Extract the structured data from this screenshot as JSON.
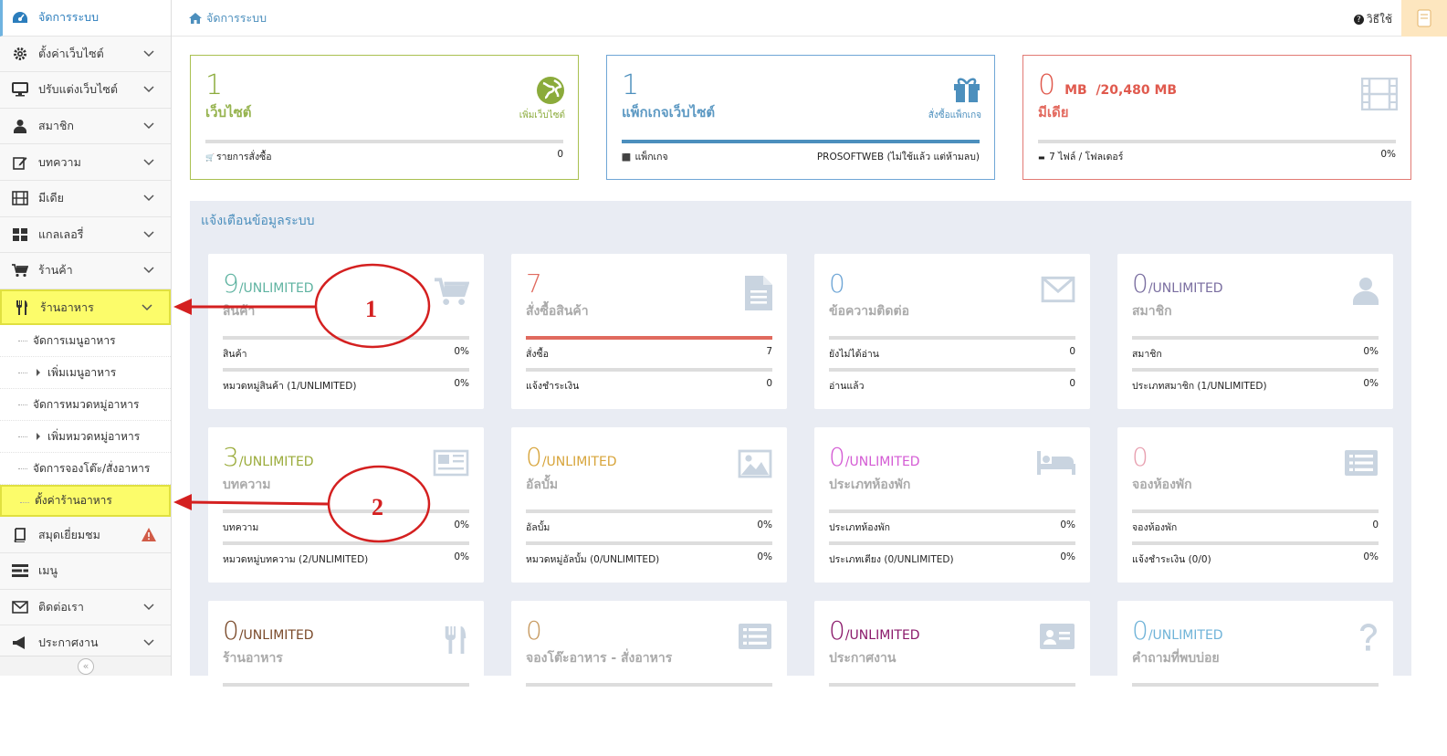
{
  "sidebar": {
    "items": [
      {
        "label": "จัดการระบบ",
        "icon": "dashboard-icon",
        "chevron": false,
        "active": true
      },
      {
        "label": "ตั้งค่าเว็บไซต์",
        "icon": "gear-icon",
        "chevron": true
      },
      {
        "label": "ปรับแต่งเว็บไซต์",
        "icon": "desktop-icon",
        "chevron": true
      },
      {
        "label": "สมาชิก",
        "icon": "user-icon",
        "chevron": true
      },
      {
        "label": "บทความ",
        "icon": "edit-icon",
        "chevron": true
      },
      {
        "label": "มีเดีย",
        "icon": "film-icon",
        "chevron": true
      },
      {
        "label": "แกลเลอรี่",
        "icon": "grid-icon",
        "chevron": true
      },
      {
        "label": "ร้านค้า",
        "icon": "cart-icon",
        "chevron": true
      },
      {
        "label": "ร้านอาหาร",
        "icon": "cutlery-icon",
        "chevron": true,
        "highlight": true
      }
    ],
    "restaurant_sub": [
      {
        "label": "จัดการเมนูอาหาร",
        "level": 1
      },
      {
        "label": "เพิ่มเมนูอาหาร",
        "level": 2
      },
      {
        "label": "จัดการหมวดหมู่อาหาร",
        "level": 1
      },
      {
        "label": "เพิ่มหมวดหมู่อาหาร",
        "level": 2
      },
      {
        "label": "จัดการจองโต๊ะ/สั่งอาหาร",
        "level": 1
      },
      {
        "label": "ตั้งค่าร้านอาหาร",
        "level": 1,
        "highlight": true
      }
    ],
    "items_after": [
      {
        "label": "สมุดเยี่ยมชม",
        "icon": "book-icon",
        "chevron": false,
        "warning": true
      },
      {
        "label": "เมนู",
        "icon": "menu-list-icon",
        "chevron": false
      },
      {
        "label": "ติดต่อเรา",
        "icon": "envelope-icon",
        "chevron": true
      },
      {
        "label": "ประกาศงาน",
        "icon": "megaphone-icon",
        "chevron": true
      }
    ],
    "collapse_glyph": "«"
  },
  "topbar": {
    "breadcrumb": "จัดการระบบ",
    "help": "วิธีใช้"
  },
  "summary": [
    {
      "num": "1",
      "unit": "",
      "label": "เว็บไซต์",
      "link": "เพิ่มเว็บไซต์",
      "foot_left": "รายการสั่งซื้อ",
      "foot_right": "0",
      "color": "#8bab3b",
      "border": "#a9c050",
      "icon": "globe-icon",
      "bar_fill": 0,
      "bar_color": "#ddd"
    },
    {
      "num": "1",
      "unit": "",
      "label": "แพ็กเกจเว็บไซต์",
      "link": "สั่งซื้อแพ็กเกจ",
      "foot_left": "แพ็กเกจ",
      "foot_right": "PROSOFTWEB (ไม่ใช้แล้ว แต่ห้ามลบ)",
      "color": "#4c8fbd",
      "border": "#6fa6d6",
      "icon": "gift-icon",
      "bar_fill": 1,
      "bar_color": "#4c8fbd"
    },
    {
      "num": "0",
      "unit": "MB  /20,480 MB",
      "label": "มีเดีย",
      "link": "",
      "foot_left": "7 ไฟล์ / โฟลเดอร์",
      "foot_right": "0%",
      "color": "#e05a4e",
      "border": "#e27a74",
      "icon": "film-icon",
      "bar_fill": 0,
      "bar_color": "#ddd"
    }
  ],
  "panel_title": "แจ้งเตือนข้อมูลระบบ",
  "cards": [
    {
      "num": "9",
      "unit": "/UNLIMITED",
      "label": "สินค้า",
      "icon": "cart-icon",
      "color": "#5fb3a1",
      "r1": [
        "สินค้า",
        "0%"
      ],
      "r2": [
        "หมวดหมู่สินค้า (1/UNLIMITED)",
        "0%"
      ],
      "bar1": 0,
      "barcolor": "#ddd"
    },
    {
      "num": "7",
      "unit": "",
      "label": "สั่งซื้อสินค้า",
      "icon": "file-icon",
      "color": "#e06a5e",
      "r1": [
        "สั่งซื้อ",
        "7"
      ],
      "r2": [
        "แจ้งชำระเงิน",
        "0"
      ],
      "bar1": 1,
      "barcolor": "#e06a5e"
    },
    {
      "num": "0",
      "unit": "",
      "label": "ข้อความติดต่อ",
      "icon": "envelope-icon",
      "color": "#6fa6d6",
      "r1": [
        "ยังไม่ได้อ่าน",
        "0"
      ],
      "r2": [
        "อ่านแล้ว",
        "0"
      ],
      "bar1": 0,
      "barcolor": "#ddd"
    },
    {
      "num": "0",
      "unit": "/UNLIMITED",
      "label": "สมาชิก",
      "icon": "user-icon",
      "color": "#7a6ea0",
      "r1": [
        "สมาชิก",
        "0%"
      ],
      "r2": [
        "ประเภทสมาชิก (1/UNLIMITED)",
        "0%"
      ],
      "bar1": 0,
      "barcolor": "#ddd"
    },
    {
      "num": "3",
      "unit": "/UNLIMITED",
      "label": "บทความ",
      "icon": "newspaper-icon",
      "color": "#9aab3a",
      "r1": [
        "บทความ",
        "0%"
      ],
      "r2": [
        "หมวดหมู่บทความ (2/UNLIMITED)",
        "0%"
      ],
      "bar1": 0,
      "barcolor": "#ddd"
    },
    {
      "num": "0",
      "unit": "/UNLIMITED",
      "label": "อัลบั้ม",
      "icon": "picture-icon",
      "color": "#d7a43a",
      "r1": [
        "อัลบั้ม",
        "0%"
      ],
      "r2": [
        "หมวดหมู่อัลบั้ม (0/UNLIMITED)",
        "0%"
      ],
      "bar1": 0,
      "barcolor": "#ddd"
    },
    {
      "num": "0",
      "unit": "/UNLIMITED",
      "label": "ประเภทห้องพัก",
      "icon": "bed-icon",
      "color": "#d45bd4",
      "r1": [
        "ประเภทห้องพัก",
        "0%"
      ],
      "r2": [
        "ประเภทเตียง (0/UNLIMITED)",
        "0%"
      ],
      "bar1": 0,
      "barcolor": "#ddd"
    },
    {
      "num": "0",
      "unit": "",
      "label": "จองห้องพัก",
      "icon": "list-icon",
      "color": "#e8a0b0",
      "r1": [
        "จองห้องพัก",
        "0"
      ],
      "r2": [
        "แจ้งชำระเงิน (0/0)",
        "0%"
      ],
      "bar1": 0,
      "barcolor": "#ddd"
    },
    {
      "num": "0",
      "unit": "/UNLIMITED",
      "label": "ร้านอาหาร",
      "icon": "cutlery-icon",
      "color": "#7a4a2a",
      "r1": [
        "",
        ""
      ],
      "r2": [
        "",
        ""
      ],
      "bar1": 0,
      "barcolor": "#ddd"
    },
    {
      "num": "0",
      "unit": "",
      "label": "จองโต๊ะอาหาร - สั่งอาหาร",
      "icon": "list-icon",
      "color": "#c79a60",
      "r1": [
        "",
        ""
      ],
      "r2": [
        "",
        ""
      ],
      "bar1": 0,
      "barcolor": "#ddd"
    },
    {
      "num": "0",
      "unit": "/UNLIMITED",
      "label": "ประกาศงาน",
      "icon": "id-card-icon",
      "color": "#8b1a6b",
      "r1": [
        "",
        ""
      ],
      "r2": [
        "",
        ""
      ],
      "bar1": 0,
      "barcolor": "#ddd"
    },
    {
      "num": "0",
      "unit": "/UNLIMITED",
      "label": "คำถามที่พบบ่อย",
      "icon": "question-icon",
      "color": "#6fb3d8",
      "r1": [
        "",
        ""
      ],
      "r2": [
        "",
        ""
      ],
      "bar1": 0,
      "barcolor": "#ddd"
    }
  ],
  "annotations": [
    {
      "label": "1"
    },
    {
      "label": "2"
    }
  ]
}
